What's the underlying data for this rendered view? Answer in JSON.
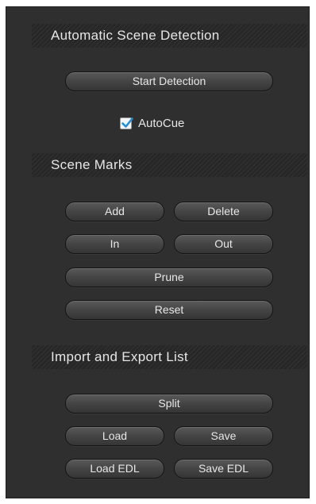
{
  "colors": {
    "panel_bg": "#2f2f2f",
    "header_bg": "#272727",
    "text": "#e6e6e6",
    "check_accent": "#1f8fd8"
  },
  "automatic_scene_detection": {
    "title": "Automatic Scene Detection",
    "start_detection_label": "Start Detection",
    "autocue": {
      "label": "AutoCue",
      "checked": true,
      "icon": "checkmark-icon"
    }
  },
  "scene_marks": {
    "title": "Scene Marks",
    "add_label": "Add",
    "delete_label": "Delete",
    "in_label": "In",
    "out_label": "Out",
    "prune_label": "Prune",
    "reset_label": "Reset"
  },
  "import_export": {
    "title": "Import and Export List",
    "split_label": "Split",
    "load_label": "Load",
    "save_label": "Save",
    "load_edl_label": "Load EDL",
    "save_edl_label": "Save EDL"
  }
}
